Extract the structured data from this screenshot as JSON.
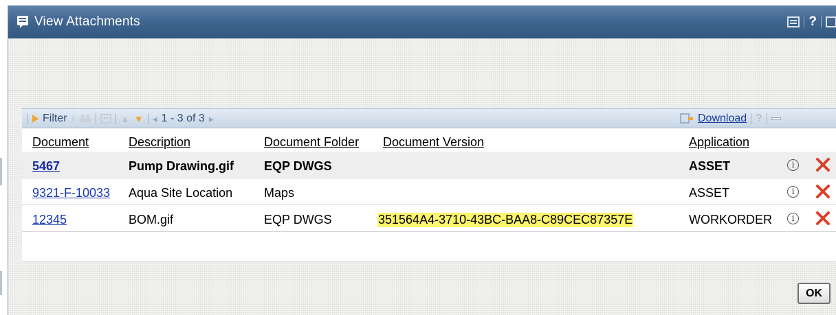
{
  "window": {
    "title": "View Attachments",
    "help_label": "?"
  },
  "toolbar": {
    "filter_label": "Filter",
    "pagination": "1 - 3 of 3",
    "download_label": "Download",
    "help_label": "?"
  },
  "table": {
    "columns": [
      "Document",
      "Description",
      "Document Folder",
      "Document Version",
      "Application"
    ],
    "rows": [
      {
        "document": "5467",
        "description": "Pump Drawing.gif",
        "folder": "EQP DWGS",
        "version": "",
        "application": "ASSET"
      },
      {
        "document": "9321-F-10033",
        "description": "Aqua Site Location",
        "folder": "Maps",
        "version": "",
        "application": "ASSET"
      },
      {
        "document": "12345",
        "description": "BOM.gif",
        "folder": "EQP DWGS",
        "version": "351564A4-3710-43BC-BAA8-C89CEC87357E",
        "application": "WORKORDER"
      }
    ],
    "info_glyph": "i"
  },
  "footer": {
    "ok_label": "OK"
  },
  "colors": {
    "titlebar": "#3f6590",
    "link": "#1a3ab5",
    "highlight": "#fdf56b",
    "delete": "#d9412b",
    "toolbar_accent": "#f0a431"
  }
}
